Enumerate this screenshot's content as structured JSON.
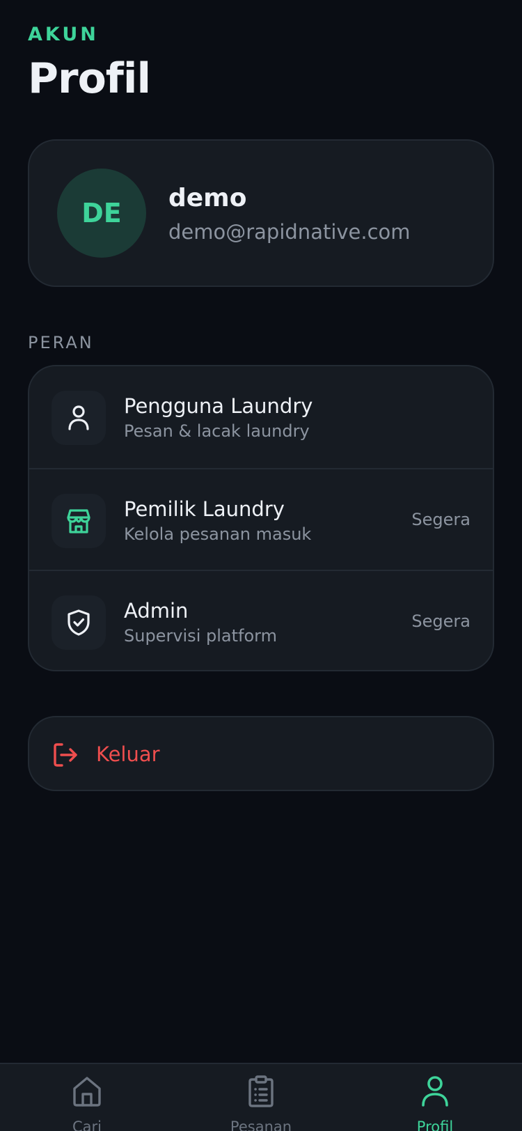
{
  "header": {
    "eyebrow": "AKUN",
    "title": "Profil"
  },
  "profile": {
    "initials": "DE",
    "name": "demo",
    "email": "demo@rapidnative.com"
  },
  "roles_section": {
    "label": "PERAN",
    "items": [
      {
        "title": "Pengguna Laundry",
        "subtitle": "Pesan & lacak laundry",
        "badge": "",
        "icon": "user-icon"
      },
      {
        "title": "Pemilik Laundry",
        "subtitle": "Kelola pesanan masuk",
        "badge": "Segera",
        "icon": "store-icon"
      },
      {
        "title": "Admin",
        "subtitle": "Supervisi platform",
        "badge": "Segera",
        "icon": "shield-check-icon"
      }
    ]
  },
  "logout": {
    "label": "Keluar",
    "icon": "logout-icon"
  },
  "tabbar": {
    "active": "Profil",
    "tabs": [
      {
        "label": "Cari",
        "icon": "home-icon"
      },
      {
        "label": "Pesanan",
        "icon": "clipboard-list-icon"
      },
      {
        "label": "Profil",
        "icon": "user-icon"
      }
    ]
  },
  "colors": {
    "background": "#0a0d14",
    "card": "#161b22",
    "accent": "#3ed49a",
    "danger": "#ef4e4e",
    "muted_text": "#8c94a0"
  }
}
